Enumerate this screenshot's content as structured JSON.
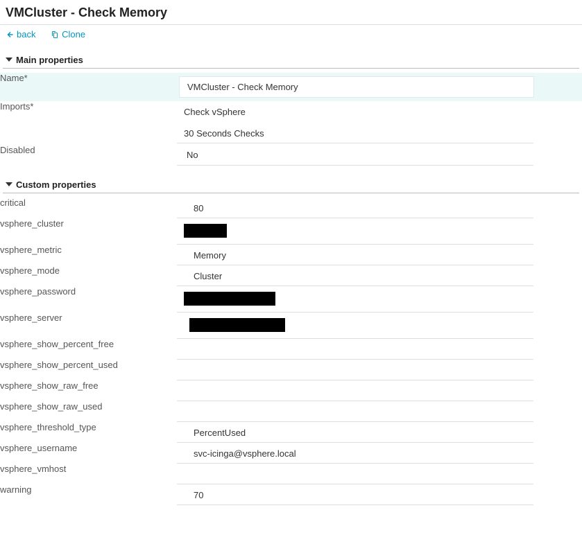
{
  "header": {
    "title": "VMCluster - Check Memory"
  },
  "actions": {
    "back": "back",
    "clone": "Clone"
  },
  "sections": {
    "main": {
      "title": "Main properties",
      "fields": {
        "name_label": "Name*",
        "name_value": "VMCluster - Check Memory",
        "imports_label": "Imports*",
        "imports_values": {
          "a": "Check vSphere",
          "b": "30 Seconds Checks"
        },
        "disabled_label": "Disabled",
        "disabled_value": "No"
      }
    },
    "custom": {
      "title": "Custom properties",
      "props": {
        "critical": {
          "label": "critical",
          "value": "80"
        },
        "vsphere_cluster": {
          "label": "vsphere_cluster",
          "value": ""
        },
        "vsphere_metric": {
          "label": "vsphere_metric",
          "value": "Memory"
        },
        "vsphere_mode": {
          "label": "vsphere_mode",
          "value": "Cluster"
        },
        "vsphere_password": {
          "label": "vsphere_password",
          "value": ""
        },
        "vsphere_server": {
          "label": "vsphere_server",
          "value": ""
        },
        "vsphere_show_percent_free": {
          "label": "vsphere_show_percent_free",
          "value": ""
        },
        "vsphere_show_percent_used": {
          "label": "vsphere_show_percent_used",
          "value": ""
        },
        "vsphere_show_raw_free": {
          "label": "vsphere_show_raw_free",
          "value": ""
        },
        "vsphere_show_raw_used": {
          "label": "vsphere_show_raw_used",
          "value": ""
        },
        "vsphere_threshold_type": {
          "label": "vsphere_threshold_type",
          "value": "PercentUsed"
        },
        "vsphere_username": {
          "label": "vsphere_username",
          "value": "svc-icinga@vsphere.local"
        },
        "vsphere_vmhost": {
          "label": "vsphere_vmhost",
          "value": ""
        },
        "warning": {
          "label": "warning",
          "value": "70"
        }
      }
    }
  }
}
